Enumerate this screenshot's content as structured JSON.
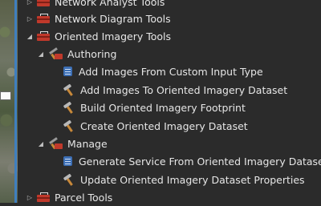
{
  "tree": {
    "network_analyst": "Network Analyst Tools",
    "network_diagram": "Network Diagram Tools",
    "oriented_imagery": "Oriented Imagery Tools",
    "authoring": "Authoring",
    "add_images_custom": "Add Images From Custom Input Type",
    "add_images_dataset": "Add Images To Oriented Imagery Dataset",
    "build_footprint": "Build Oriented Imagery Footprint",
    "create_dataset": "Create Oriented Imagery Dataset",
    "manage": "Manage",
    "generate_service": "Generate Service From Oriented Imagery Dataset",
    "update_properties": "Update Oriented Imagery Dataset Properties",
    "parcel_tools": "Parcel Tools"
  },
  "colors": {
    "background": "#2b2b2b",
    "text": "#e6e6e6",
    "toolbox": "#c0392b",
    "script": "#3d6fb5"
  }
}
